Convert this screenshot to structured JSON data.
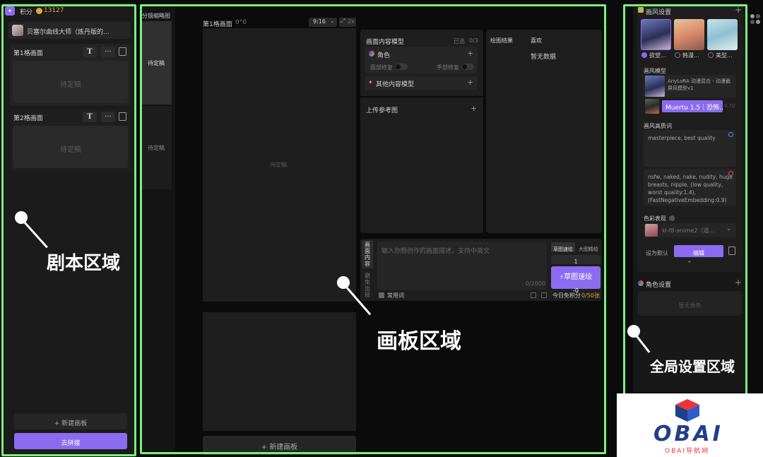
{
  "left": {
    "points_label": "积分",
    "points_value": "13127",
    "script_title": "贝塞尔曲线大师（炼丹版的...",
    "panels": [
      {
        "title": "第1格画面",
        "placeholder": "待定稿"
      },
      {
        "title": "第2格画面",
        "placeholder": "待定稿"
      }
    ],
    "text_icon": "T",
    "more_icon": "···",
    "new_panel_label": "+  新建画板",
    "stitch_label": "去拼接",
    "annotation": "剧本区域"
  },
  "storyboard": {
    "title": "分镜缩略图",
    "items": [
      "待定稿",
      "待定稿"
    ]
  },
  "canvas": {
    "frame_title": "第1格画面",
    "frame_angle": "0°0",
    "ratio": "9:16",
    "zoom": "2x",
    "placeholder": "待定稿",
    "new_canvas_label": "+   新建画板",
    "annotation": "画板区域"
  },
  "content_model": {
    "title": "画面内容模型",
    "selected_label": "已选",
    "selected_count": "0/3",
    "character_label": "角色",
    "face_fix_label": "面部修复",
    "hand_fix_label": "手部修复",
    "other_model_label": "其他内容模型",
    "upload_label": "上传参考图"
  },
  "results": {
    "title": "绘图结果",
    "like_label": "喜欢",
    "empty_text": "暂无数据"
  },
  "prompt": {
    "tab_content": [
      "画",
      "面",
      "内",
      "容"
    ],
    "tab_scene": [
      "避",
      "免",
      "出",
      "现"
    ],
    "placeholder": "输入你想创作的画面描述，支持中英文",
    "counter": "0/2000",
    "common_words_label": "常用词",
    "mode_fast": "草图速绘",
    "mode_fine": "大图精绘",
    "count": "1",
    "sketch_button": "草图速绘",
    "sketch_cost": "-0",
    "free_label": "今日免积分",
    "free_value": "0/50张"
  },
  "global": {
    "style_title": "画风设置",
    "styles": [
      "欲望...",
      "韩漫...",
      "美型..."
    ],
    "style_model_label": "画风模型",
    "model_name": "AnyLoRA 动漫混合 - 动漫截屏风模型v1",
    "lora_name": "Muertu 1.5｜恐怖...",
    "lora_weight": "0.70",
    "style_words_label": "画风高质词",
    "positive_prompt": "masterpiece, best quality",
    "negative_prompt": "nsfw, naked, nake, nudity, huge breasts, nipple, (low quality, worst quality:1.4), (FastNegativeEmbedding:0.9)",
    "color_label": "色彩表现",
    "color_value": "kl-f8-anime2（适...",
    "set_default_label": "设为默认",
    "edit_label": "编辑",
    "character_title": "角色设置",
    "no_character": "暂无角色",
    "annotation": "全局设置区域"
  },
  "watermark": {
    "brand": "OBAI",
    "subtitle": "OBAI导航网"
  },
  "colors": {
    "accent": "#8b6cf0",
    "frame_green": "#7bf07b",
    "gold": "#e0a43a"
  }
}
